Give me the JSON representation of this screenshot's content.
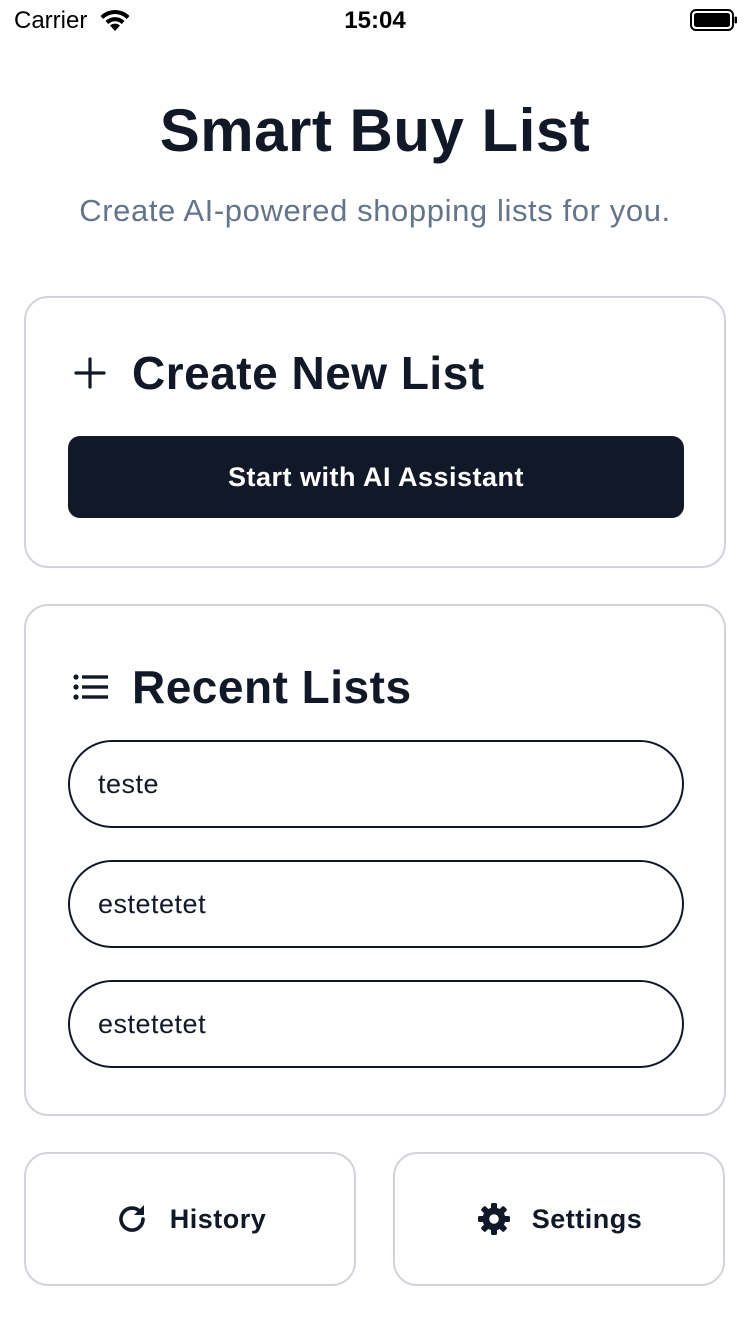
{
  "status_bar": {
    "carrier": "Carrier",
    "time": "15:04",
    "wifi_icon": "wifi-icon",
    "battery_icon": "battery-icon"
  },
  "header": {
    "title": "Smart Buy List",
    "subtitle": "Create AI-powered shopping lists for you."
  },
  "create_card": {
    "icon": "plus-icon",
    "title": "Create New List",
    "button_label": "Start with AI Assistant"
  },
  "recent_card": {
    "icon": "list-icon",
    "title": "Recent Lists",
    "items": [
      {
        "label": "teste"
      },
      {
        "label": "estetetet"
      },
      {
        "label": "estetetet"
      }
    ]
  },
  "bottom_nav": {
    "history": {
      "icon": "refresh-icon",
      "label": "History"
    },
    "settings": {
      "icon": "gear-icon",
      "label": "Settings"
    }
  },
  "colors": {
    "primary": "#111827",
    "subtitle": "#64748b",
    "border": "#d1d5db",
    "background": "#ffffff"
  }
}
